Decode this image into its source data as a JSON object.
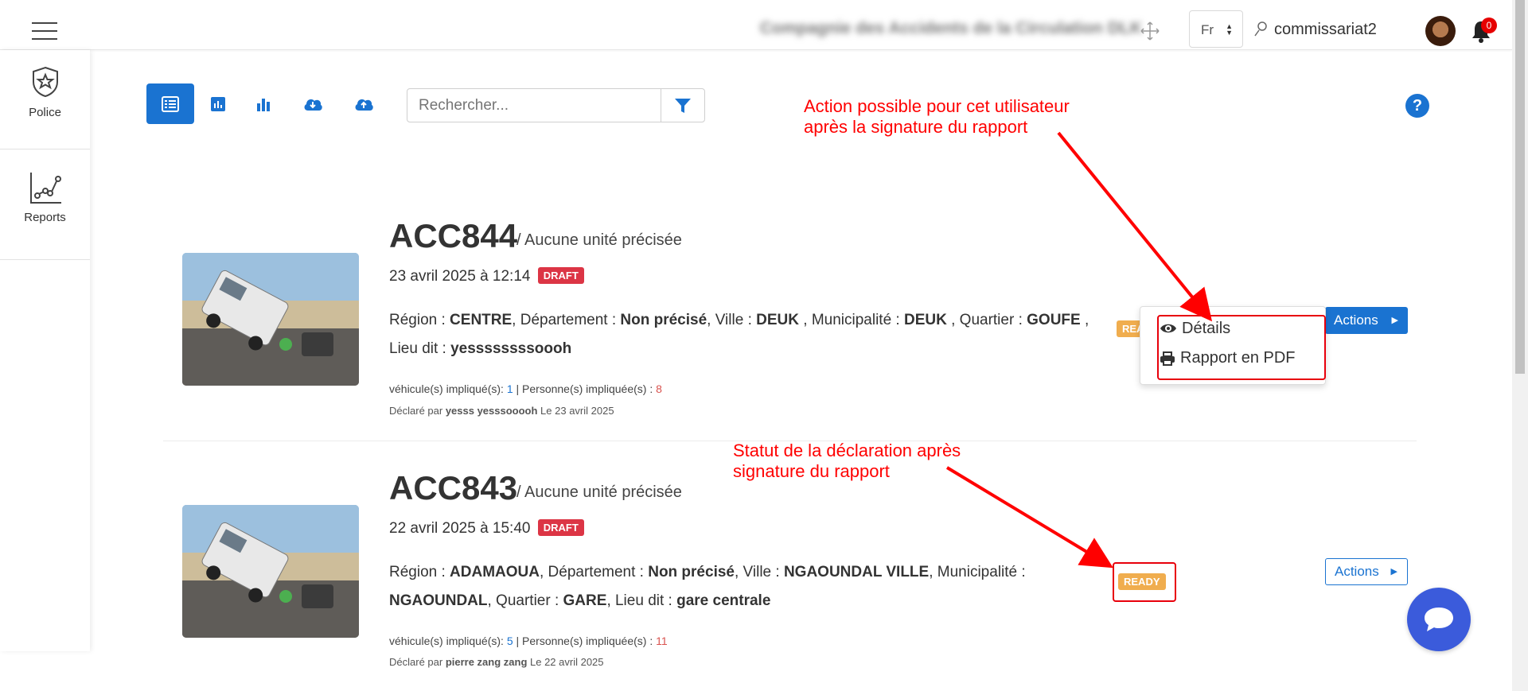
{
  "header": {
    "company": "Compagnie des Accidents de la Circulation DLK",
    "language": "Fr",
    "username": "commissariat2",
    "notifications": "0"
  },
  "sidebar": {
    "items": [
      {
        "label": "Police",
        "icon": "shield-star-icon"
      },
      {
        "label": "Reports",
        "icon": "line-chart-icon"
      }
    ]
  },
  "toolbar": {
    "search_placeholder": "Rechercher...",
    "buttons": [
      "list-view-icon",
      "chart-small-icon",
      "bar-chart-icon",
      "cloud-download-icon",
      "cloud-upload-icon"
    ]
  },
  "help_label": "?",
  "records": [
    {
      "code": "ACC844",
      "unit": "/ Aucune unité précisée",
      "date": "23 avril 2025 à 12:14",
      "status_badge": "DRAFT",
      "region_label": "Région : ",
      "region": "CENTRE",
      "dept_label": ", Département : ",
      "dept": "Non précisé",
      "ville_label": ", Ville : ",
      "ville": "DEUK",
      "muni_label": " , Municipalité : ",
      "muni": "DEUK",
      "quartier_label": " , Quartier : ",
      "quartier": "GOUFE",
      "lieu_label": " , Lieu dit : ",
      "lieu": "yessssssssoooh",
      "vehicles_label": "véhicule(s) impliqué(s): ",
      "vehicles": "1",
      "persons_label": " | Personne(s) impliquée(s) : ",
      "persons": "8",
      "declared_label": "Déclaré par ",
      "declared_by": "yesss yesssooooh",
      "declared_date": " Le 23 avril 2025",
      "ready": "READY",
      "actions": "Actions"
    },
    {
      "code": "ACC843",
      "unit": "/ Aucune unité précisée",
      "date": "22 avril 2025 à 15:40",
      "status_badge": "DRAFT",
      "region_label": "Région : ",
      "region": "ADAMAOUA",
      "dept_label": ", Département : ",
      "dept": "Non précisé",
      "ville_label": ", Ville : ",
      "ville": "NGAOUNDAL VILLE",
      "muni_label": ", Municipalité : ",
      "muni": "NGAOUNDAL",
      "quartier_label": ", Quartier : ",
      "quartier": "GARE",
      "lieu_label": ", Lieu dit : ",
      "lieu": "gare centrale",
      "vehicles_label": "véhicule(s) impliqué(s): ",
      "vehicles": "5",
      "persons_label": " | Personne(s) impliquée(s) : ",
      "persons": "11",
      "declared_label": "Déclaré par ",
      "declared_by": "pierre zang zang",
      "declared_date": " Le 22 avril 2025",
      "ready": "READY",
      "actions": "Actions"
    }
  ],
  "dropdown": {
    "items": [
      "Détails",
      "Rapport en PDF"
    ]
  },
  "annotations": {
    "top": [
      "Action possible pour cet utilisateur",
      "après la signature du rapport"
    ],
    "bottom": [
      "Statut de la déclaration après",
      "signature du rapport"
    ]
  },
  "colors": {
    "primary": "#1a73d1",
    "draft": "#dc3545",
    "ready": "#f0ad4e",
    "annotation": "#ff0000"
  }
}
